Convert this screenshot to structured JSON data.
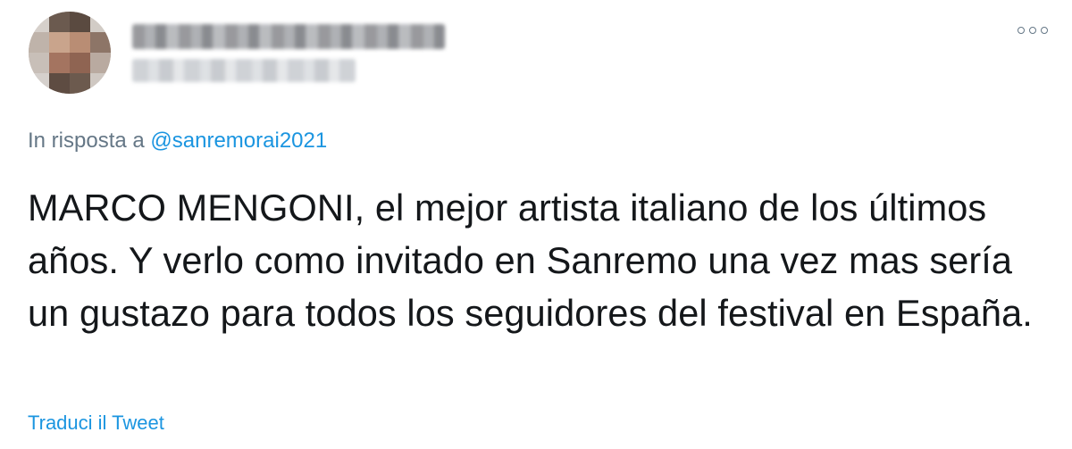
{
  "tweet": {
    "reply_prefix": "In risposta a",
    "reply_handle": "@sanremorai2021",
    "text": "MARCO MENGONI, el mejor artista italiano de los últimos años. Y verlo como invitado en Sanremo una vez mas sería un gustazo para todos los seguidores del festival en España.",
    "translate_label": "Traduci il Tweet"
  },
  "icons": {
    "more": "more-options-icon"
  },
  "colors": {
    "text": "#14171a",
    "secondary": "#657786",
    "link": "#1b95e0"
  }
}
